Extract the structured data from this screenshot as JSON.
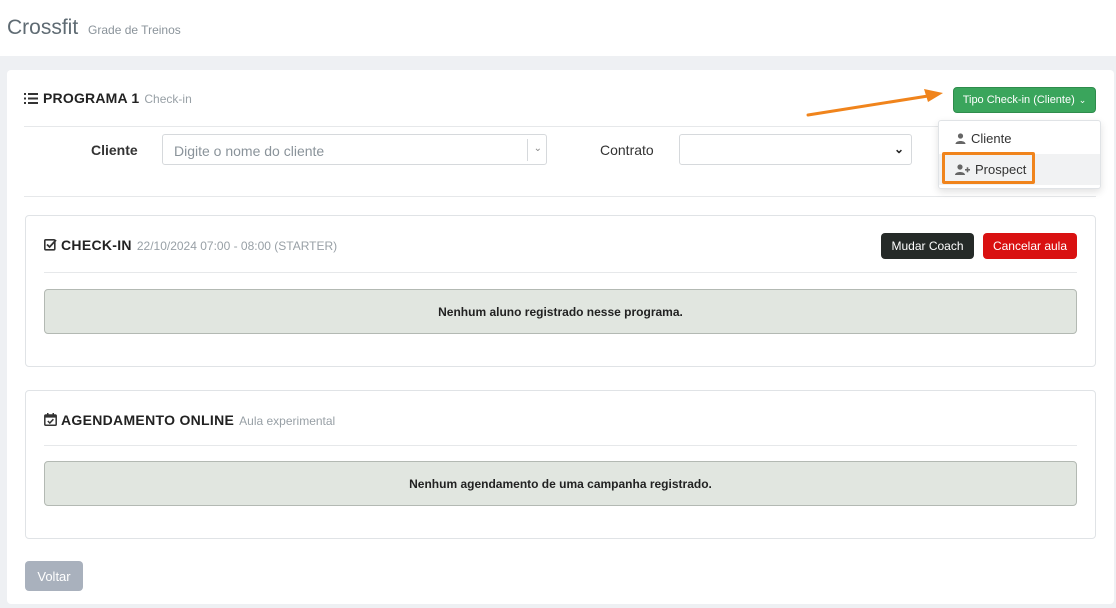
{
  "app": {
    "title": "Crossfit",
    "subtitle": "Grade de Treinos"
  },
  "program": {
    "title": "PROGRAMA 1",
    "subtitle": "Check-in",
    "type_button": "Tipo Check-in (Cliente)",
    "dropdown_items": [
      {
        "label": "Cliente",
        "icon": "user-icon"
      },
      {
        "label": "Prospect",
        "icon": "user-plus-icon"
      }
    ]
  },
  "form": {
    "cliente_label": "Cliente",
    "cliente_placeholder": "Digite o nome do cliente",
    "contrato_label": "Contrato",
    "contrato_value": ""
  },
  "checkin": {
    "title": "CHECK-IN",
    "subtitle": "22/10/2024 07:00 - 08:00 (STARTER)",
    "coach_button": "Mudar Coach",
    "cancel_button": "Cancelar aula",
    "empty_message": "Nenhum aluno registrado nesse programa."
  },
  "agenda": {
    "title": "AGENDAMENTO ONLINE",
    "subtitle": "Aula experimental",
    "empty_message": "Nenhum agendamento de uma campanha registrado."
  },
  "footer": {
    "back_button": "Voltar"
  },
  "colors": {
    "success": "#3aa55c",
    "danger": "#d91111",
    "dark": "#252a28",
    "highlight": "#f0841c",
    "muted_button": "#a9b1bd"
  }
}
